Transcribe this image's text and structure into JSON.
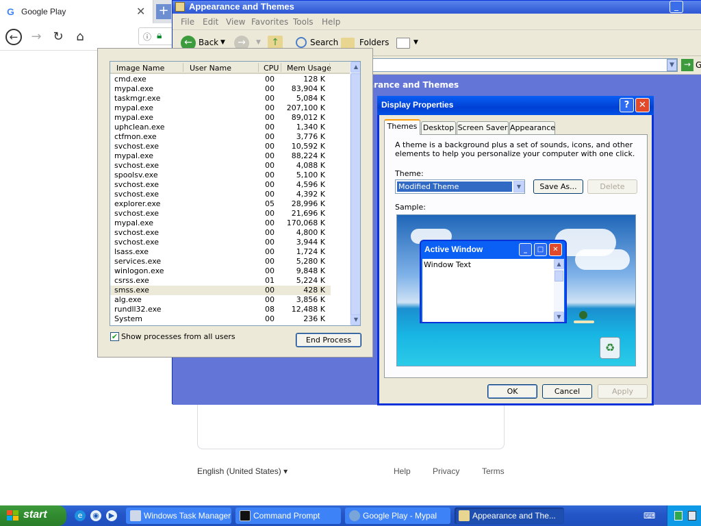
{
  "browser": {
    "tab_title": "Google Play",
    "favicon_letter": "G",
    "footer": {
      "language": "English (United States)",
      "help": "Help",
      "privacy": "Privacy",
      "terms": "Terms"
    }
  },
  "explorer": {
    "title": "Appearance and Themes",
    "menu": [
      "File",
      "Edit",
      "View",
      "Favorites",
      "Tools",
      "Help"
    ],
    "toolbar": {
      "back": "Back",
      "search": "Search",
      "folders": "Folders"
    },
    "address_go": "G",
    "heading": "arance and Themes"
  },
  "task_manager": {
    "columns": [
      "Image Name",
      "User Name",
      "CPU",
      "Mem Usage"
    ],
    "processes": [
      {
        "name": "cmd.exe",
        "cpu": "00",
        "mem": "128 K"
      },
      {
        "name": "mypal.exe",
        "cpu": "00",
        "mem": "83,904 K"
      },
      {
        "name": "taskmgr.exe",
        "cpu": "00",
        "mem": "5,084 K"
      },
      {
        "name": "mypal.exe",
        "cpu": "00",
        "mem": "207,100 K"
      },
      {
        "name": "mypal.exe",
        "cpu": "00",
        "mem": "89,012 K"
      },
      {
        "name": "uphclean.exe",
        "cpu": "00",
        "mem": "1,340 K"
      },
      {
        "name": "ctfmon.exe",
        "cpu": "00",
        "mem": "3,776 K"
      },
      {
        "name": "svchost.exe",
        "cpu": "00",
        "mem": "10,592 K"
      },
      {
        "name": "mypal.exe",
        "cpu": "00",
        "mem": "88,224 K"
      },
      {
        "name": "svchost.exe",
        "cpu": "00",
        "mem": "4,088 K"
      },
      {
        "name": "spoolsv.exe",
        "cpu": "00",
        "mem": "5,100 K"
      },
      {
        "name": "svchost.exe",
        "cpu": "00",
        "mem": "4,596 K"
      },
      {
        "name": "svchost.exe",
        "cpu": "00",
        "mem": "4,392 K"
      },
      {
        "name": "explorer.exe",
        "cpu": "05",
        "mem": "28,996 K"
      },
      {
        "name": "svchost.exe",
        "cpu": "00",
        "mem": "21,696 K"
      },
      {
        "name": "mypal.exe",
        "cpu": "00",
        "mem": "170,068 K"
      },
      {
        "name": "svchost.exe",
        "cpu": "00",
        "mem": "4,800 K"
      },
      {
        "name": "svchost.exe",
        "cpu": "00",
        "mem": "3,944 K"
      },
      {
        "name": "lsass.exe",
        "cpu": "00",
        "mem": "1,724 K"
      },
      {
        "name": "services.exe",
        "cpu": "00",
        "mem": "5,280 K"
      },
      {
        "name": "winlogon.exe",
        "cpu": "00",
        "mem": "9,848 K"
      },
      {
        "name": "csrss.exe",
        "cpu": "01",
        "mem": "5,224 K"
      },
      {
        "name": "smss.exe",
        "cpu": "00",
        "mem": "428 K"
      },
      {
        "name": "alg.exe",
        "cpu": "00",
        "mem": "3,856 K"
      },
      {
        "name": "rundll32.exe",
        "cpu": "08",
        "mem": "12,488 K"
      },
      {
        "name": "System",
        "cpu": "00",
        "mem": "236 K"
      }
    ],
    "selected_index": 22,
    "show_all_label": "Show processes from all users",
    "show_all_checked": true,
    "end_process": "End Process"
  },
  "display_properties": {
    "title": "Display Properties",
    "help_label": "?",
    "tabs": [
      "Themes",
      "Desktop",
      "Screen Saver",
      "Appearance"
    ],
    "active_tab": "Themes",
    "description": "A theme is a background plus a set of sounds, icons, and other elements to help you personalize your computer with one click.",
    "theme_label": "Theme:",
    "theme_value": "Modified Theme",
    "save_as": "Save As...",
    "delete": "Delete",
    "sample_label": "Sample:",
    "sample_window_title": "Active Window",
    "sample_window_text": "Window Text",
    "ok": "OK",
    "cancel": "Cancel",
    "apply": "Apply"
  },
  "taskbar": {
    "start": "start",
    "tasks": [
      {
        "label": "Windows Task Manager",
        "active": false
      },
      {
        "label": "Command Prompt",
        "active": false
      },
      {
        "label": "Google Play - Mypal",
        "active": false
      },
      {
        "label": "Appearance and The...",
        "active": true
      }
    ]
  },
  "colors": {
    "xp_title_blue": "#0a5ff5",
    "start_green": "#308a2f",
    "taskbar_blue": "#2456c8",
    "selection_blue": "#316ac5"
  }
}
